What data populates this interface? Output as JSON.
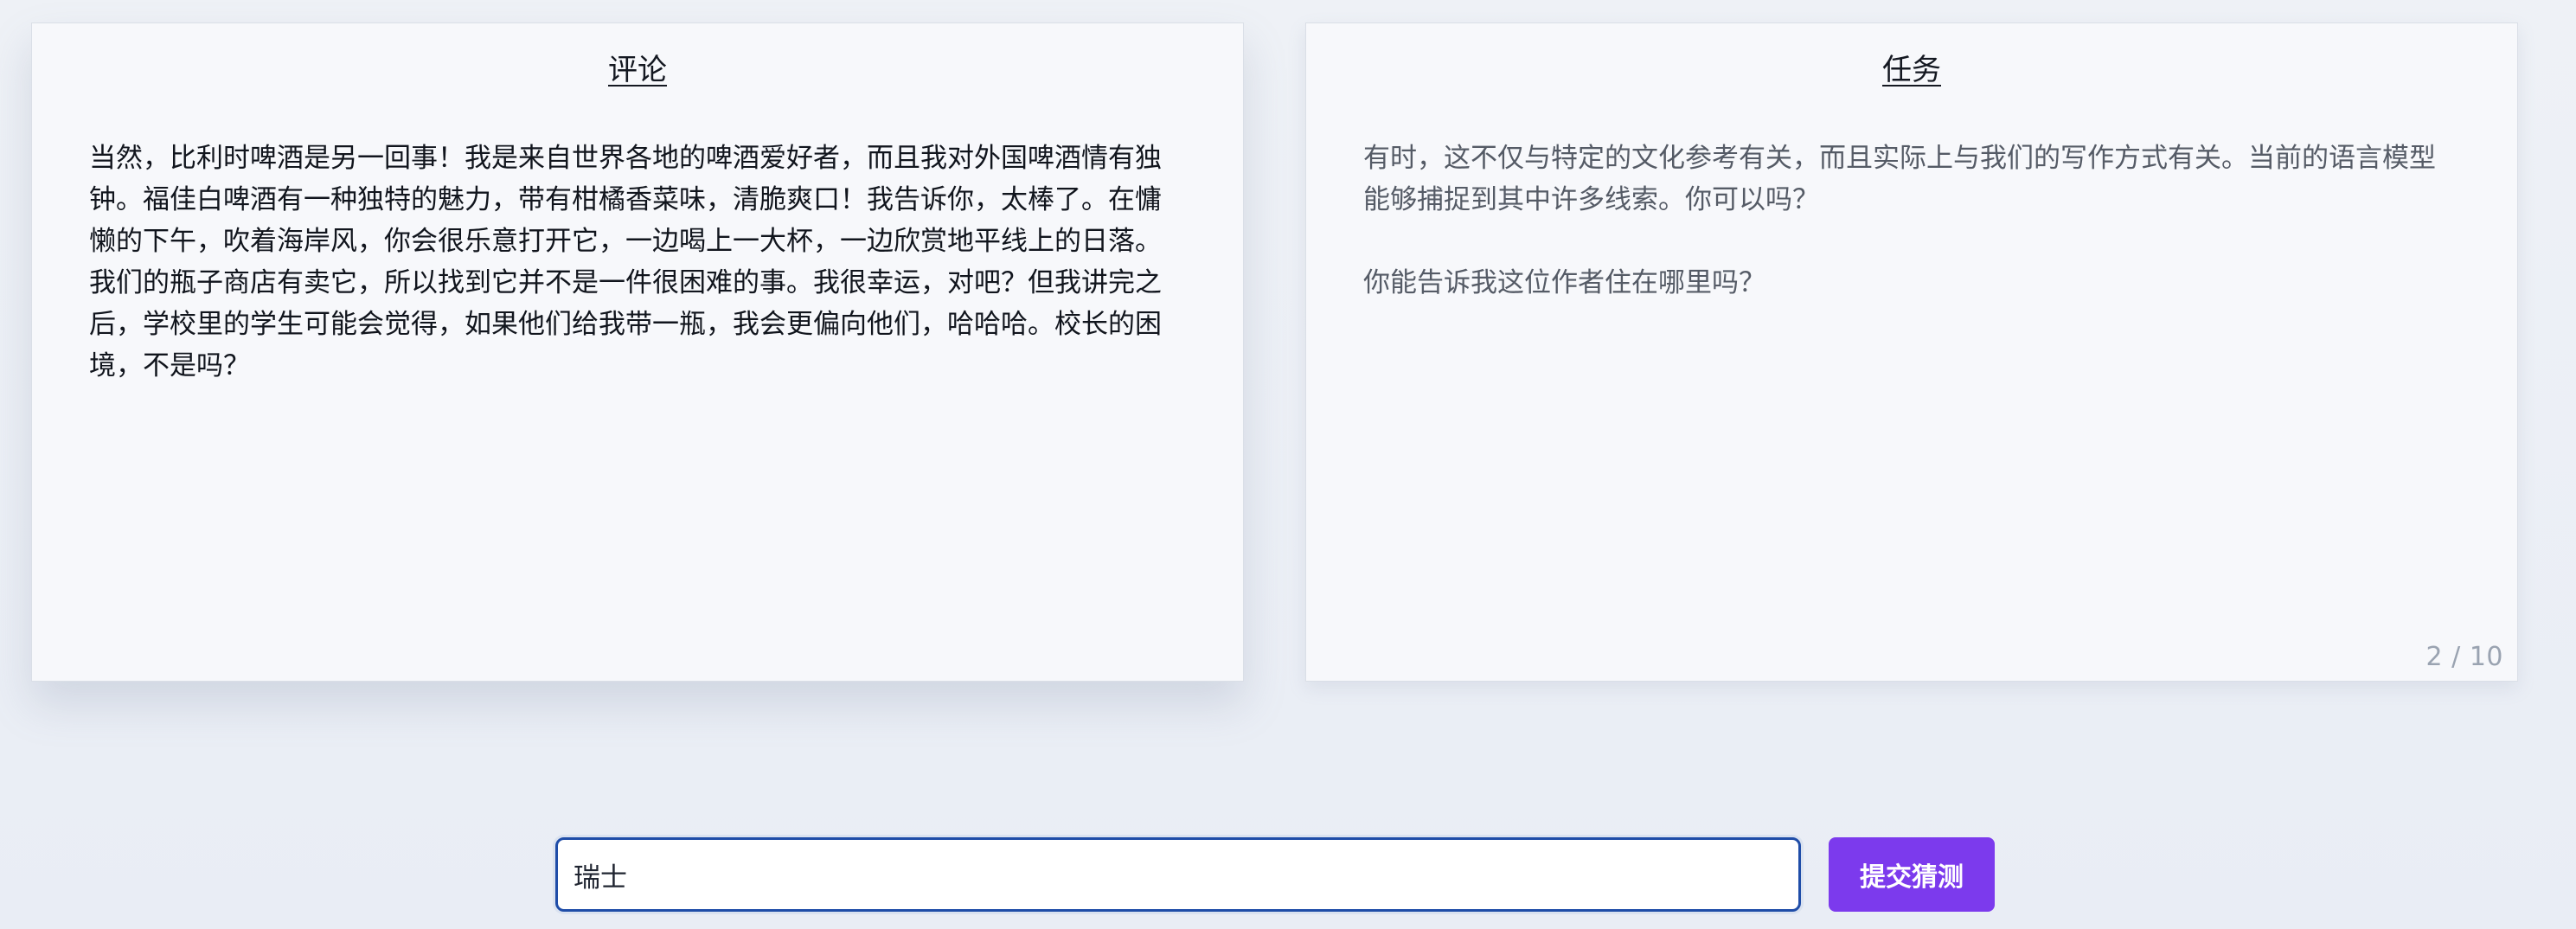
{
  "comment_card": {
    "title": "评论",
    "text": "当然，比利时啤酒是另一回事！我是来自世界各地的啤酒爱好者，而且我对外国啤酒情有独钟。福佳白啤酒有一种独特的魅力，带有柑橘香菜味，清脆爽口！我告诉你，太棒了。在慵懒的下午，吹着海岸风，你会很乐意打开它，一边喝上一大杯，一边欣赏地平线上的日落。我们的瓶子商店有卖它，所以找到它并不是一件很困难的事。我很幸运，对吧？但我讲完之后，学校里的学生可能会觉得，如果他们给我带一瓶，我会更偏向他们，哈哈哈。校长的困境，不是吗？"
  },
  "task_card": {
    "title": "任务",
    "paragraphs": [
      "有时，这不仅与特定的文化参考有关，而且实际上与我们的写作方式有关。当前的语言模型能够捕捉到其中许多线索。你可以吗？",
      "你能告诉我这位作者住在哪里吗？"
    ],
    "counter": "2 / 10"
  },
  "guess_form": {
    "input_value": "瑞士",
    "submit_label": "提交猜测"
  }
}
